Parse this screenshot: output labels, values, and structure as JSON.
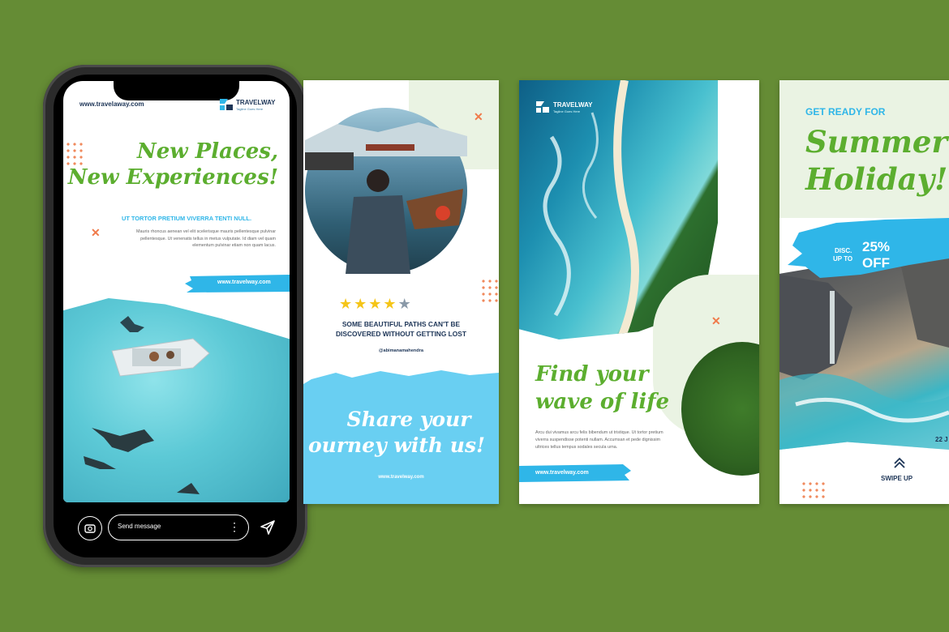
{
  "colors": {
    "background": "#658c35",
    "green": "#5cae2f",
    "blue": "#2fb6e8",
    "navy": "#1d3557",
    "accent": "#f07a4a"
  },
  "phone": {
    "website": "www.travelaway.com",
    "brand_name": "TRAVELWAY",
    "brand_tagline": "Tagline Goes Here",
    "headline_1": "New Places,",
    "headline_2": "New Experiences!",
    "subheading": "UT TORTOR PRETIUM VIVERRA TENTI NULL.",
    "body": "Mauris rhoncus aenean vel elit scelerisque mauris pellentesque pulvinar pellentesque. Ut venenatis tellus in metus vulputate. Id diam vel quam elementum pulvinar etiam non quam lacus.",
    "url_banner": "www.travelway.com",
    "send_placeholder": "Send message",
    "icons": {
      "camera": "camera-icon",
      "more": "more-dots-icon",
      "send": "send-icon"
    }
  },
  "card2": {
    "rating": 4,
    "rating_max": 5,
    "quote_1": "SOME BEAUTIFUL PATHS CAN'T BE",
    "quote_2": "DISCOVERED WITHOUT GETTING LOST",
    "handle": "@abimanamahendra",
    "cta_1": "Share your",
    "cta_2": "ourney with us!",
    "url": "www.travelway.com"
  },
  "card3": {
    "brand_name": "TRAVELWAY",
    "brand_tagline": "Tagline Goes Here",
    "headline_1": "Find your",
    "headline_2": "wave of life",
    "body": "Arcu dui vivamus arcu felis bibendum ut tristique. Ut tortor pretium viverra suspendisse potenti nullam. Accumsan et pede dignissim ultrices tellus tempus sodales secula urna.",
    "url": "www.travelway.com"
  },
  "card4": {
    "kicker": "GET READY FOR",
    "headline_1": "Summer",
    "headline_2": "Holiday!",
    "disc_1": "DISC.",
    "disc_2": "UP TO",
    "discount": "25%",
    "off": "OFF",
    "date_partial": "22 J",
    "swipe": "SWIPE UP"
  }
}
